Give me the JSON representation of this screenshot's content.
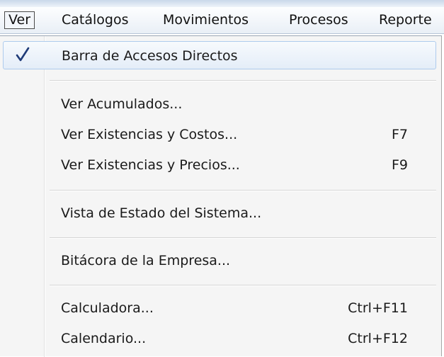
{
  "menubar": {
    "items": [
      "Ver",
      "Catálogos",
      "Movimientos",
      "Procesos",
      "Reporte"
    ]
  },
  "dropdown": {
    "items": [
      {
        "label": "Barra de Accesos Directos",
        "shortcut": "",
        "checked": true
      },
      {
        "label": "Ver Acumulados...",
        "shortcut": ""
      },
      {
        "label": "Ver Existencias y Costos...",
        "shortcut": "F7"
      },
      {
        "label": "Ver Existencias y Precios...",
        "shortcut": "F9"
      },
      {
        "label": "Vista de Estado del Sistema...",
        "shortcut": ""
      },
      {
        "label": "Bitácora de la Empresa...",
        "shortcut": ""
      },
      {
        "label": "Calculadora...",
        "shortcut": "Ctrl+F11"
      },
      {
        "label": "Calendario...",
        "shortcut": "Ctrl+F12"
      }
    ]
  },
  "colors": {
    "checkmark": "#1f3b78",
    "highlight_border": "#aecbed"
  },
  "icons": {
    "check": "check-icon"
  }
}
